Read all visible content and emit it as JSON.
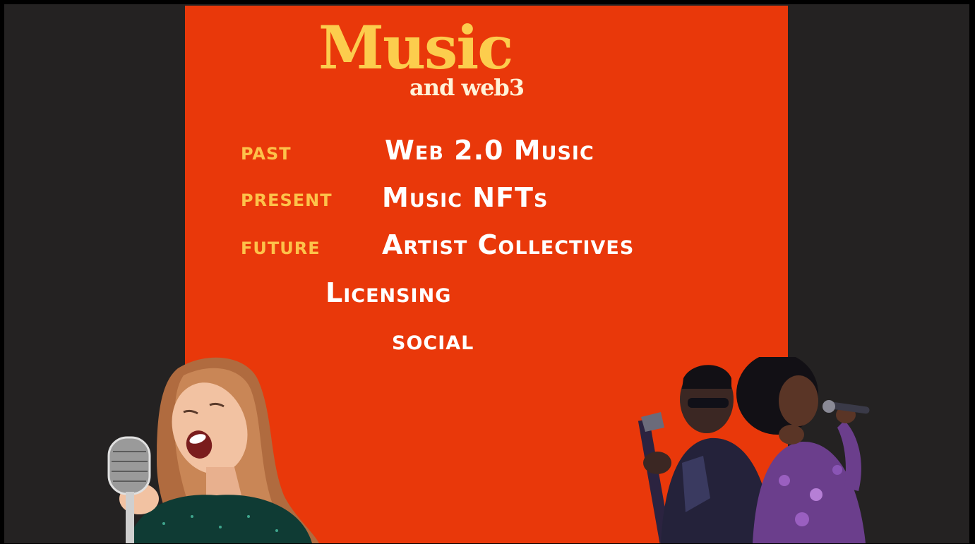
{
  "slide": {
    "title": "Music",
    "subtitle": "and web3",
    "timeline": [
      {
        "tag": "past",
        "item": "Web 2.0 Music"
      },
      {
        "tag": "present",
        "item": "Music NFTs"
      },
      {
        "tag": "future",
        "item": "Artist Collectives"
      }
    ],
    "extras": [
      "Licensing",
      "social"
    ]
  },
  "colors": {
    "background": "#242222",
    "slide": "#e9380a",
    "title": "#fccd4d",
    "tag": "#fdc24a",
    "item": "#ffffff"
  },
  "images": {
    "left": "woman-singing-into-vintage-microphone",
    "right": "guitarist-and-singer-with-microphone"
  }
}
